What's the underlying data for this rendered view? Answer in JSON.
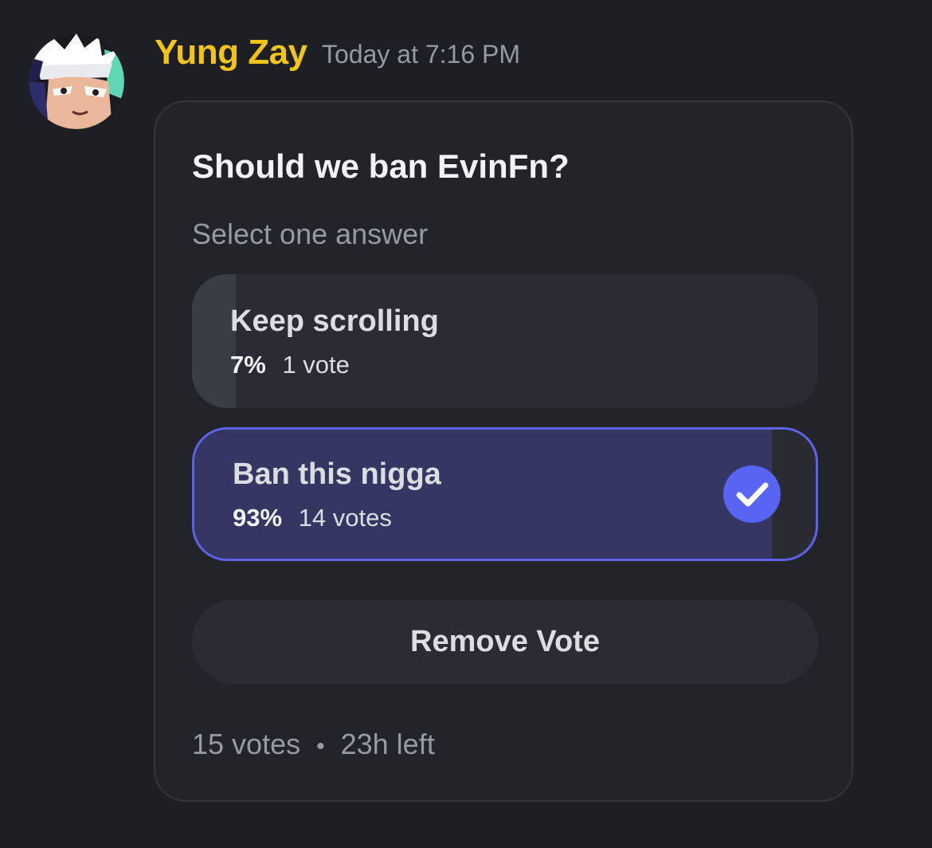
{
  "message": {
    "author": "Yung Zay",
    "timestamp": "Today at 7:16 PM",
    "author_color": "#f0c419"
  },
  "poll": {
    "question": "Should we ban EvinFn?",
    "hint": "Select one answer",
    "answers": [
      {
        "label": "Keep scrolling",
        "percent": "7%",
        "votes": "1 vote",
        "share": 0.07,
        "selected": false
      },
      {
        "label": "Ban this nigga",
        "percent": "93%",
        "votes": "14 votes",
        "share": 0.93,
        "selected": true
      }
    ],
    "remove_vote_label": "Remove Vote",
    "total_votes": "15 votes",
    "separator": "•",
    "time_left": "23h left",
    "accent_color": "#5865f2"
  }
}
